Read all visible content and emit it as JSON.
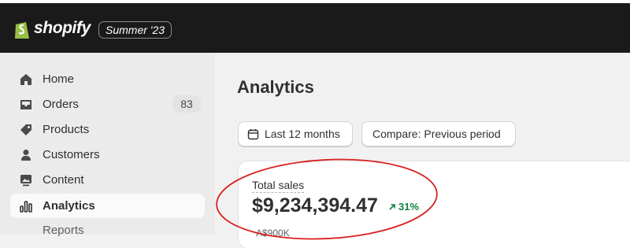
{
  "topbar": {
    "brand": "shopify",
    "edition": "Summer '23",
    "accent": "#95bf47"
  },
  "sidebar": {
    "items": [
      {
        "label": "Home",
        "icon": "home-icon"
      },
      {
        "label": "Orders",
        "icon": "inbox-icon",
        "badge": "83"
      },
      {
        "label": "Products",
        "icon": "tag-icon"
      },
      {
        "label": "Customers",
        "icon": "person-icon"
      },
      {
        "label": "Content",
        "icon": "image-icon"
      },
      {
        "label": "Analytics",
        "icon": "bar-chart-icon",
        "active": true
      },
      {
        "label": "Reports",
        "sub": true
      }
    ]
  },
  "main": {
    "title": "Analytics",
    "date_button": "Last 12 months",
    "compare_button": "Compare: Previous period",
    "card": {
      "label": "Total sales",
      "value": "$9,234,394.47",
      "trend": "31%",
      "trend_color": "#108043",
      "axis_label": "A$900K"
    },
    "annotation_color": "#d92020"
  }
}
